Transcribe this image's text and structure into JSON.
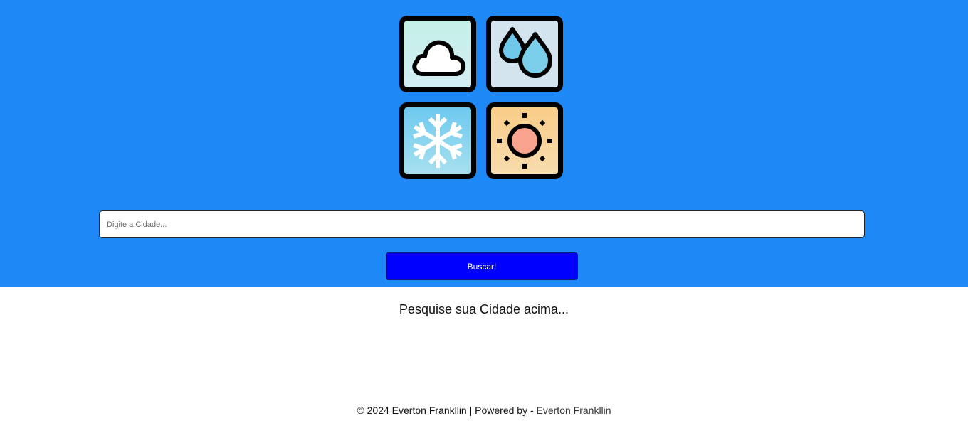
{
  "header": {
    "background_color": "#1e88f6",
    "icons": [
      {
        "name": "cloud-icon"
      },
      {
        "name": "water-drops-icon"
      },
      {
        "name": "snowflake-icon"
      },
      {
        "name": "sun-icon"
      }
    ]
  },
  "search": {
    "placeholder": "Digite a Cidade...",
    "value": "",
    "button_label": "Buscar!",
    "button_color": "#0000ff"
  },
  "main": {
    "prompt": "Pesquise sua Cidade acima..."
  },
  "footer": {
    "copyright": "© 2024 Everton Frankllin | Powered by - ",
    "link_text": "Everton Frankllin"
  }
}
